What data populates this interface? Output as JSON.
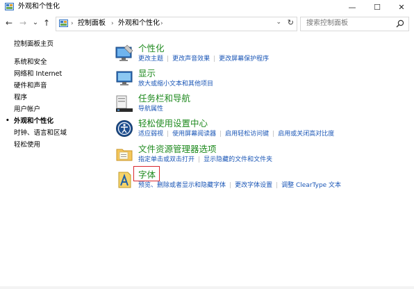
{
  "window": {
    "title": "外观和个性化",
    "minimize_glyph": "—",
    "maximize_glyph": "☐",
    "close_glyph": "✕"
  },
  "nav": {
    "back_glyph": "←",
    "forward_glyph": "→",
    "recent_glyph": "⌄",
    "up_glyph": "↑"
  },
  "address": {
    "crumbs": [
      "控制面板",
      "外观和个性化"
    ],
    "separator": "›",
    "dropdown_glyph": "⌄",
    "refresh_glyph": "↻"
  },
  "search": {
    "placeholder": "搜索控制面板"
  },
  "sidebar": {
    "home": "控制面板主页",
    "items": [
      {
        "label": "系统和安全",
        "current": false
      },
      {
        "label": "网络和 Internet",
        "current": false
      },
      {
        "label": "硬件和声音",
        "current": false
      },
      {
        "label": "程序",
        "current": false
      },
      {
        "label": "用户帐户",
        "current": false
      },
      {
        "label": "外观和个性化",
        "current": true
      },
      {
        "label": "时钟、语言和区域",
        "current": false
      },
      {
        "label": "轻松使用",
        "current": false
      }
    ],
    "current_marker": "•"
  },
  "categories": [
    {
      "title": "个性化",
      "icon": "personalization-icon",
      "links": [
        "更改主题",
        "更改声音效果",
        "更改屏幕保护程序"
      ]
    },
    {
      "title": "显示",
      "icon": "display-monitor-icon",
      "links": [
        "放大或缩小文本和其他项目"
      ]
    },
    {
      "title": "任务栏和导航",
      "icon": "taskbar-icon",
      "links": [
        "导航属性"
      ]
    },
    {
      "title": "轻松使用设置中心",
      "icon": "ease-of-access-icon",
      "links": [
        "适应弱视",
        "使用屏幕阅读器",
        "启用轻松访问键",
        "启用或关闭高对比度"
      ]
    },
    {
      "title": "文件资源管理器选项",
      "icon": "folder-options-icon",
      "links": [
        "指定单击或双击打开",
        "显示隐藏的文件和文件夹"
      ]
    },
    {
      "title": "字体",
      "icon": "fonts-icon",
      "links": [
        "预览、删除或者显示和隐藏字体",
        "更改字体设置",
        "调整 ClearType 文本"
      ],
      "highlighted": true
    }
  ],
  "colors": {
    "category_title": "#1f8a1f",
    "link": "#1a56b6",
    "highlight_border": "#d8262e"
  }
}
